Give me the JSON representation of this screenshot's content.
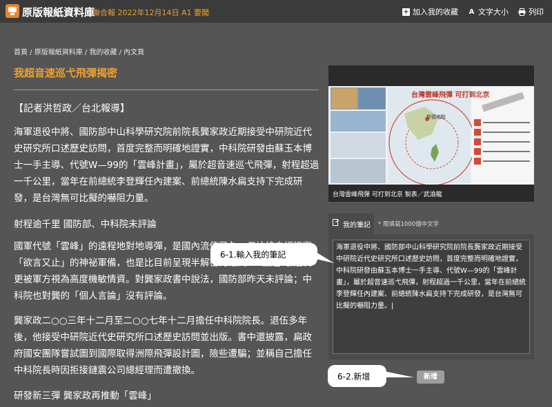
{
  "header": {
    "app_title": "原版報紙資料庫",
    "issue_info": "聯合報  2022年12月14日  A1  要聞",
    "actions": [
      {
        "label": "加入我的收藏",
        "icon": "plus-icon"
      },
      {
        "label": "文字大小",
        "icon": "font-size-icon"
      },
      {
        "label": "列印",
        "icon": "print-icon"
      }
    ]
  },
  "breadcrumb": "首頁 / 原版報紙資料庫 / 我的收藏 / 內文頁",
  "article": {
    "title": "我超音速巡弋飛彈揭密",
    "byline": "【記者洪哲政／台北報導】",
    "para1": "海軍退役中將、國防部中山科學研究院前院長龔家政近期接受中研院近代史研究所口述歷史訪問，首度完整而明確地證實，中科院研發由蘇玉本博士一手主導、代號W—99的「雲峰計畫」，屬於超音速巡弋飛彈，射程超過一千公里，當年在前總統李登輝任內建案、前總統陳水扁支持下完成研發，是台灣無可比擬的嚇阻力量。",
    "subhead1": "射程逾千里 國防部、中科院未評論",
    "para2": "國軍代號「雲峰」的遠程地對地導彈，是國內流傳已久、但始終未經證實「欲言又止」的神祕軍備，也是比目前呈現半解密的雄風二E型巡弋飛彈，更被軍方視為高度機敏情資。對龔家政書中說法，國防部昨天未評論；中科院也對龔的「個人言論」沒有評論。",
    "para3": "龔家政二○○三年十二月至二○○七年十二月擔任中科院院長。退伍多年後，他接受中研院近代史研究所口述歷史訪問並出版。書中還披露，扁政府國安團隊嘗試圖到國際取得洲際飛彈設計圖，險些遭騙；並稱自己擔任中科院長時因拒接鏈震公司總經理而遭撤換。",
    "subhead2": "研發新三彈 龔家政再推動「雲峰」"
  },
  "photo": {
    "graphic_title": "台灣雲峰飛彈  可打到北京",
    "map_label": "新德地點",
    "caption": "台灣雲峰飛彈 可打到北京 製表／武渝龍"
  },
  "notes": {
    "tab_label": "我的筆記",
    "hint": "* 限填寫1000個中文字",
    "text": "海軍退役中將、國防部中山科學研究院前院長龔家政近期接受中研院近代史研究所口述歷史訪問，首度完整而明確地證實，中科院研發由蘇玉本博士一手主導、代號W—99的「雲峰計畫」，屬於超音速巡弋飛彈，射程超過一千公里，當年在前總統李登輝任內建案、前總統陳水扁支持下完成研發，是台灣無可比擬的嚇阻力量。|",
    "add_label": "新增"
  },
  "callouts": {
    "step1": "6-1.輸入我的筆記",
    "step2": "6-2.新增"
  },
  "colors": {
    "accent": "#f0a030",
    "background": "#555555",
    "topbar": "#3b3b3b"
  }
}
